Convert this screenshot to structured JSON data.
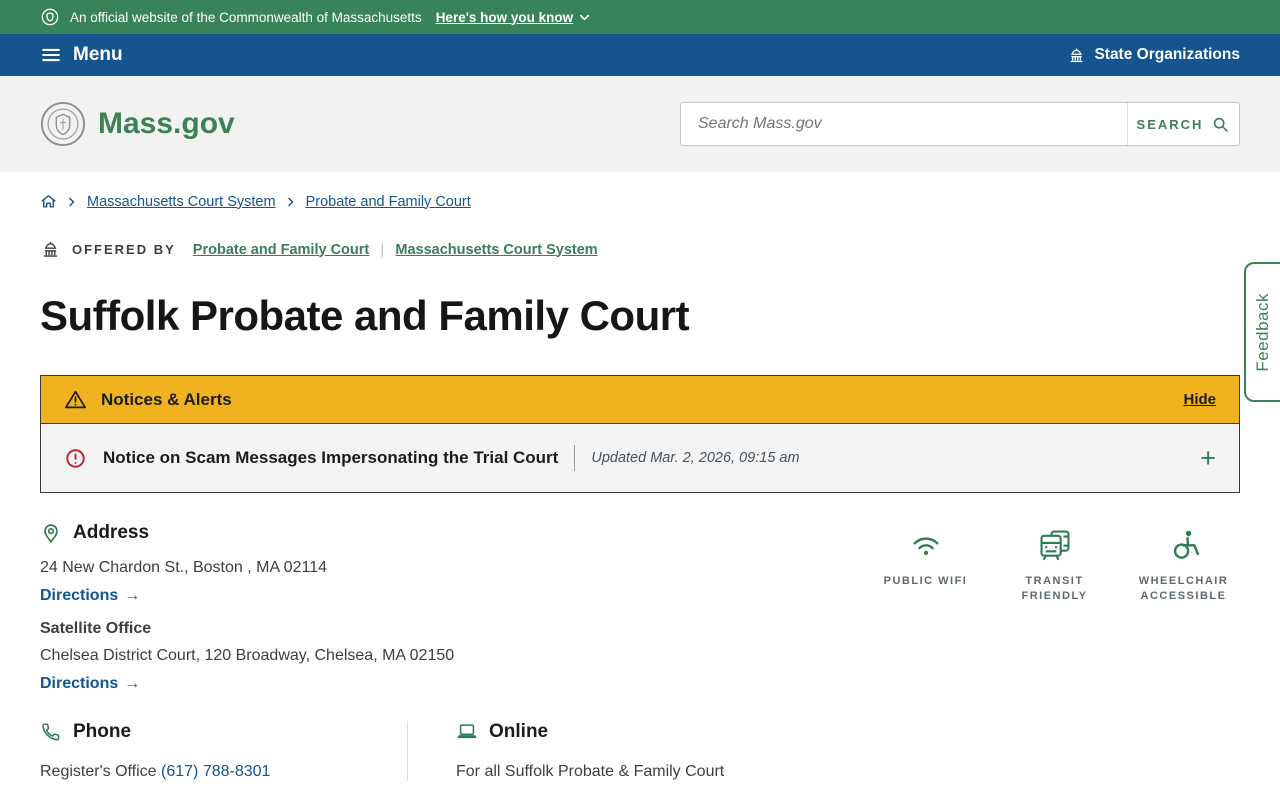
{
  "banner": {
    "official_text": "An official website of the Commonwealth of Massachusetts",
    "how_link_label": "Here's how you know"
  },
  "nav": {
    "menu_label": "Menu",
    "state_orgs_label": "State Organizations"
  },
  "header": {
    "logo_text": "Mass.gov",
    "search_placeholder": "Search Mass.gov",
    "search_button_label": "SEARCH"
  },
  "breadcrumb": {
    "links": [
      "Massachusetts Court System",
      "Probate and Family Court"
    ]
  },
  "offered_by": {
    "label": "OFFERED BY",
    "links": [
      "Probate and Family Court",
      "Massachusetts Court System"
    ]
  },
  "page": {
    "title": "Suffolk Probate and Family Court"
  },
  "alerts": {
    "header_label": "Notices & Alerts",
    "hide_label": "Hide",
    "notice": {
      "title": "Notice on Scam Messages Impersonating the Trial Court",
      "updated": "Updated Mar. 2, 2026, 09:15 am"
    }
  },
  "address": {
    "heading": "Address",
    "main_line": "24 New Chardon St., Boston , MA 02114",
    "directions_label": "Directions",
    "satellite_title": "Satellite Office",
    "satellite_line": "Chelsea District Court, 120 Broadway, Chelsea, MA 02150",
    "satellite_directions_label": "Directions"
  },
  "amenities": [
    {
      "label": "PUBLIC WIFI",
      "icon": "wifi-icon"
    },
    {
      "label": "TRANSIT FRIENDLY",
      "icon": "transit-icon"
    },
    {
      "label": "WHEELCHAIR ACCESSIBLE",
      "icon": "wheelchair-icon"
    }
  ],
  "phone": {
    "heading": "Phone",
    "row_label": "Register's Office",
    "number": "(617) 788-8301"
  },
  "online": {
    "heading": "Online",
    "line": "For all Suffolk Probate & Family Court"
  },
  "feedback": {
    "label": "Feedback"
  },
  "icons": {
    "arrow_right": "→",
    "plus": "+",
    "offered_divider": "|"
  },
  "colors": {
    "banner_green": "#388357",
    "nav_blue": "#14558F",
    "header_gray": "#f2f2f1",
    "alert_gold": "#F0B21E",
    "link_blue": "#14558F",
    "link_green": "#3A7D57",
    "alert_red": "#C1222B",
    "brand_green_text": "#3D8254"
  }
}
